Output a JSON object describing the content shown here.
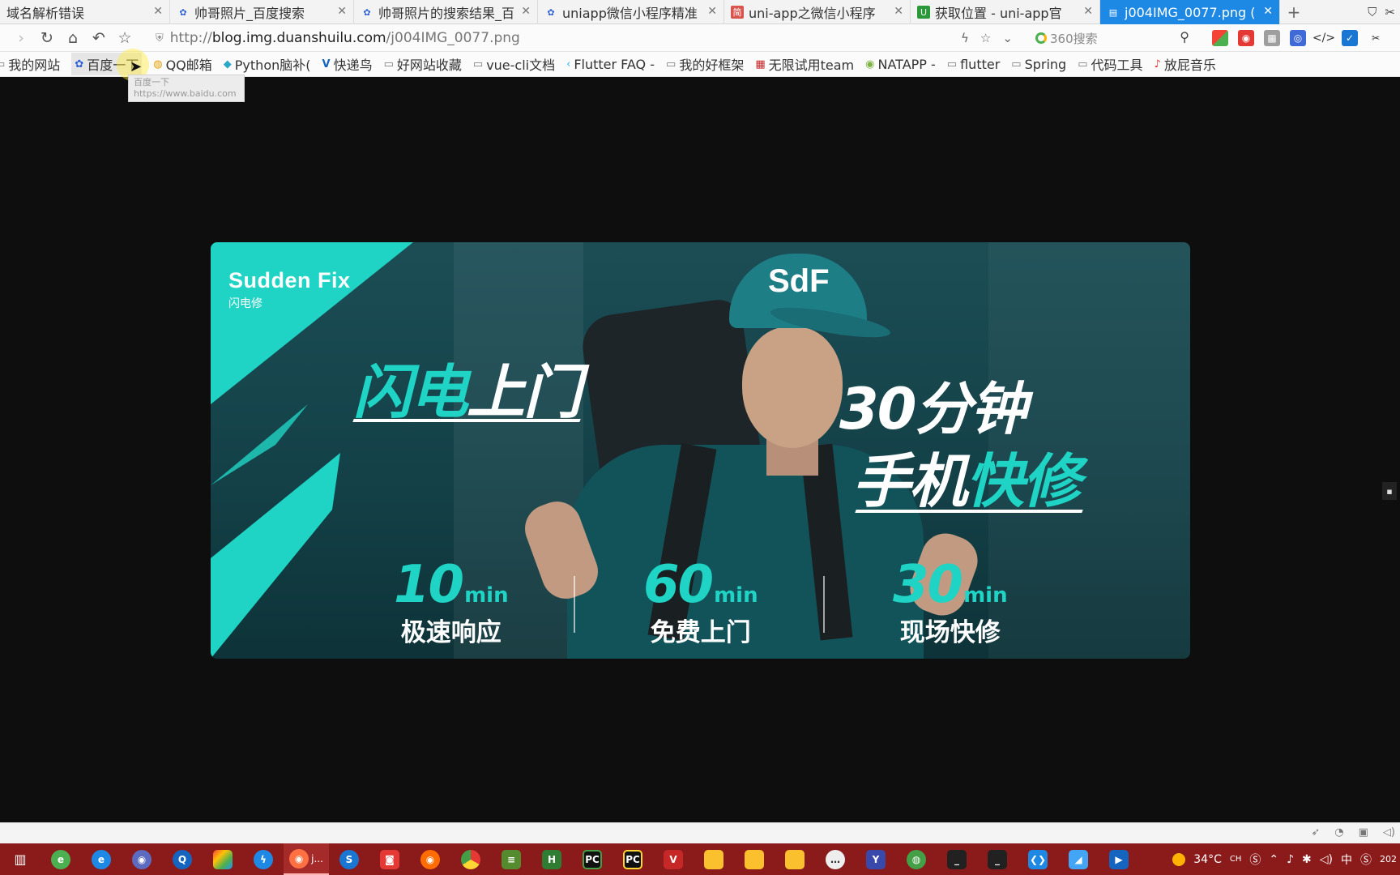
{
  "tabs": [
    {
      "label": "域名解析错误",
      "icon": "none"
    },
    {
      "label": "帅哥照片_百度搜索",
      "icon": "baidu-paw-icon"
    },
    {
      "label": "帅哥照片的搜索结果_百",
      "icon": "baidu-paw-icon"
    },
    {
      "label": "uniapp微信小程序精准",
      "icon": "baidu-paw-icon"
    },
    {
      "label": "uni-app之微信小程序",
      "icon": "jianshu-icon"
    },
    {
      "label": "获取位置 - uni-app官",
      "icon": "uniapp-icon"
    },
    {
      "label": "j004IMG_0077.png (",
      "icon": "page-icon"
    }
  ],
  "nav": {
    "url_proto": "http://",
    "url_host": "blog.img.duanshuilu.com",
    "url_path": "/j004IMG_0077.png",
    "search_placeholder": "360搜索"
  },
  "bookmarks": [
    {
      "label": "我的网站",
      "icon": "folder-icon"
    },
    {
      "label": "百度一下",
      "icon": "baidu-paw-icon"
    },
    {
      "label": "QQ邮箱",
      "icon": "qq-mail-icon"
    },
    {
      "label": "Python脑补(",
      "icon": "python-icon"
    },
    {
      "label": "快递鸟",
      "icon": "v-icon"
    },
    {
      "label": "好网站收藏",
      "icon": "folder-icon"
    },
    {
      "label": "vue-cli文档",
      "icon": "folder-icon"
    },
    {
      "label": "Flutter FAQ -",
      "icon": "flutter-icon"
    },
    {
      "label": "我的好框架",
      "icon": "folder-icon"
    },
    {
      "label": "无限试用team",
      "icon": "grid-icon"
    },
    {
      "label": "NATAPP -",
      "icon": "natapp-icon"
    },
    {
      "label": "flutter",
      "icon": "folder-icon"
    },
    {
      "label": "Spring",
      "icon": "folder-icon"
    },
    {
      "label": "代码工具",
      "icon": "folder-icon"
    },
    {
      "label": "放屁音乐",
      "icon": "music-icon"
    }
  ],
  "tooltip": {
    "title": "百度一下",
    "url": "https://www.baidu.com"
  },
  "banner": {
    "brand_en": "Sudden Fix",
    "brand_cn": "闪电修",
    "cap_logo": "SdF",
    "headline_left_accent": "闪电",
    "headline_left_rest": "上门",
    "headline_right_line1": "30分钟",
    "headline_right_line2_plain": "手机",
    "headline_right_line2_accent": "快修",
    "stats": [
      {
        "num": "10",
        "unit": "min",
        "label": "极速响应"
      },
      {
        "num": "60",
        "unit": "min",
        "label": "免费上门"
      },
      {
        "num": "30",
        "unit": "min",
        "label": "现场快修"
      }
    ],
    "colors": {
      "accent": "#1fd4c4",
      "bg": "#144148"
    }
  },
  "taskbar": {
    "weather": "34°C",
    "ime": "中",
    "ime_lang": "CH",
    "clock_fragment": "202",
    "active_item_label": "j..."
  }
}
